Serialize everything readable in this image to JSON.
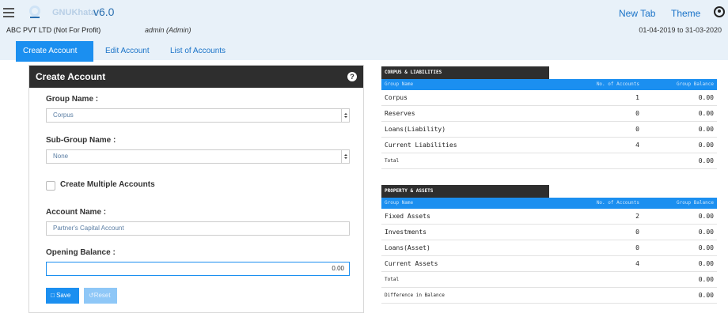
{
  "header": {
    "app_name": "GNUKhata",
    "version": "v6.0",
    "links": [
      "New Tab",
      "Theme"
    ],
    "company": "ABC PVT LTD (Not For Profit)",
    "user": "admin (Admin)",
    "period": "01-04-2019 to 31-03-2020"
  },
  "tabs": [
    "Create Account",
    "Edit Account",
    "List of Accounts"
  ],
  "form": {
    "title": "Create Account",
    "help": "?",
    "group_label": "Group Name :",
    "group_value": "Corpus",
    "subgroup_label": "Sub-Group Name :",
    "subgroup_value": "None",
    "multiple_label": "Create Multiple Accounts",
    "account_label": "Account Name :",
    "account_value": "Partner's Capital Account",
    "opening_label": "Opening Balance :",
    "opening_value": "0.00",
    "save": "Save",
    "reset": "Reset"
  },
  "liabilities": {
    "caption": "CORPUS & LIABILITIES",
    "headers": [
      "Group Name",
      "No. of Accounts",
      "Group Balance"
    ],
    "rows": [
      {
        "name": "Corpus",
        "count": "1",
        "balance": "0.00"
      },
      {
        "name": "Reserves",
        "count": "0",
        "balance": "0.00"
      },
      {
        "name": "Loans(Liability)",
        "count": "0",
        "balance": "0.00"
      },
      {
        "name": "Current Liabilities",
        "count": "4",
        "balance": "0.00"
      }
    ],
    "total_label": "Total",
    "total_value": "0.00"
  },
  "assets": {
    "caption": "PROPERTY & ASSETS",
    "headers": [
      "Group Name",
      "No. of Accounts",
      "Group Balance"
    ],
    "rows": [
      {
        "name": "Fixed Assets",
        "count": "2",
        "balance": "0.00"
      },
      {
        "name": "Investments",
        "count": "0",
        "balance": "0.00"
      },
      {
        "name": "Loans(Asset)",
        "count": "0",
        "balance": "0.00"
      },
      {
        "name": "Current Assets",
        "count": "4",
        "balance": "0.00"
      }
    ],
    "total_label": "Total",
    "total_value": "0.00",
    "diff_label": "Difference in Balance",
    "diff_value": "0.00"
  }
}
